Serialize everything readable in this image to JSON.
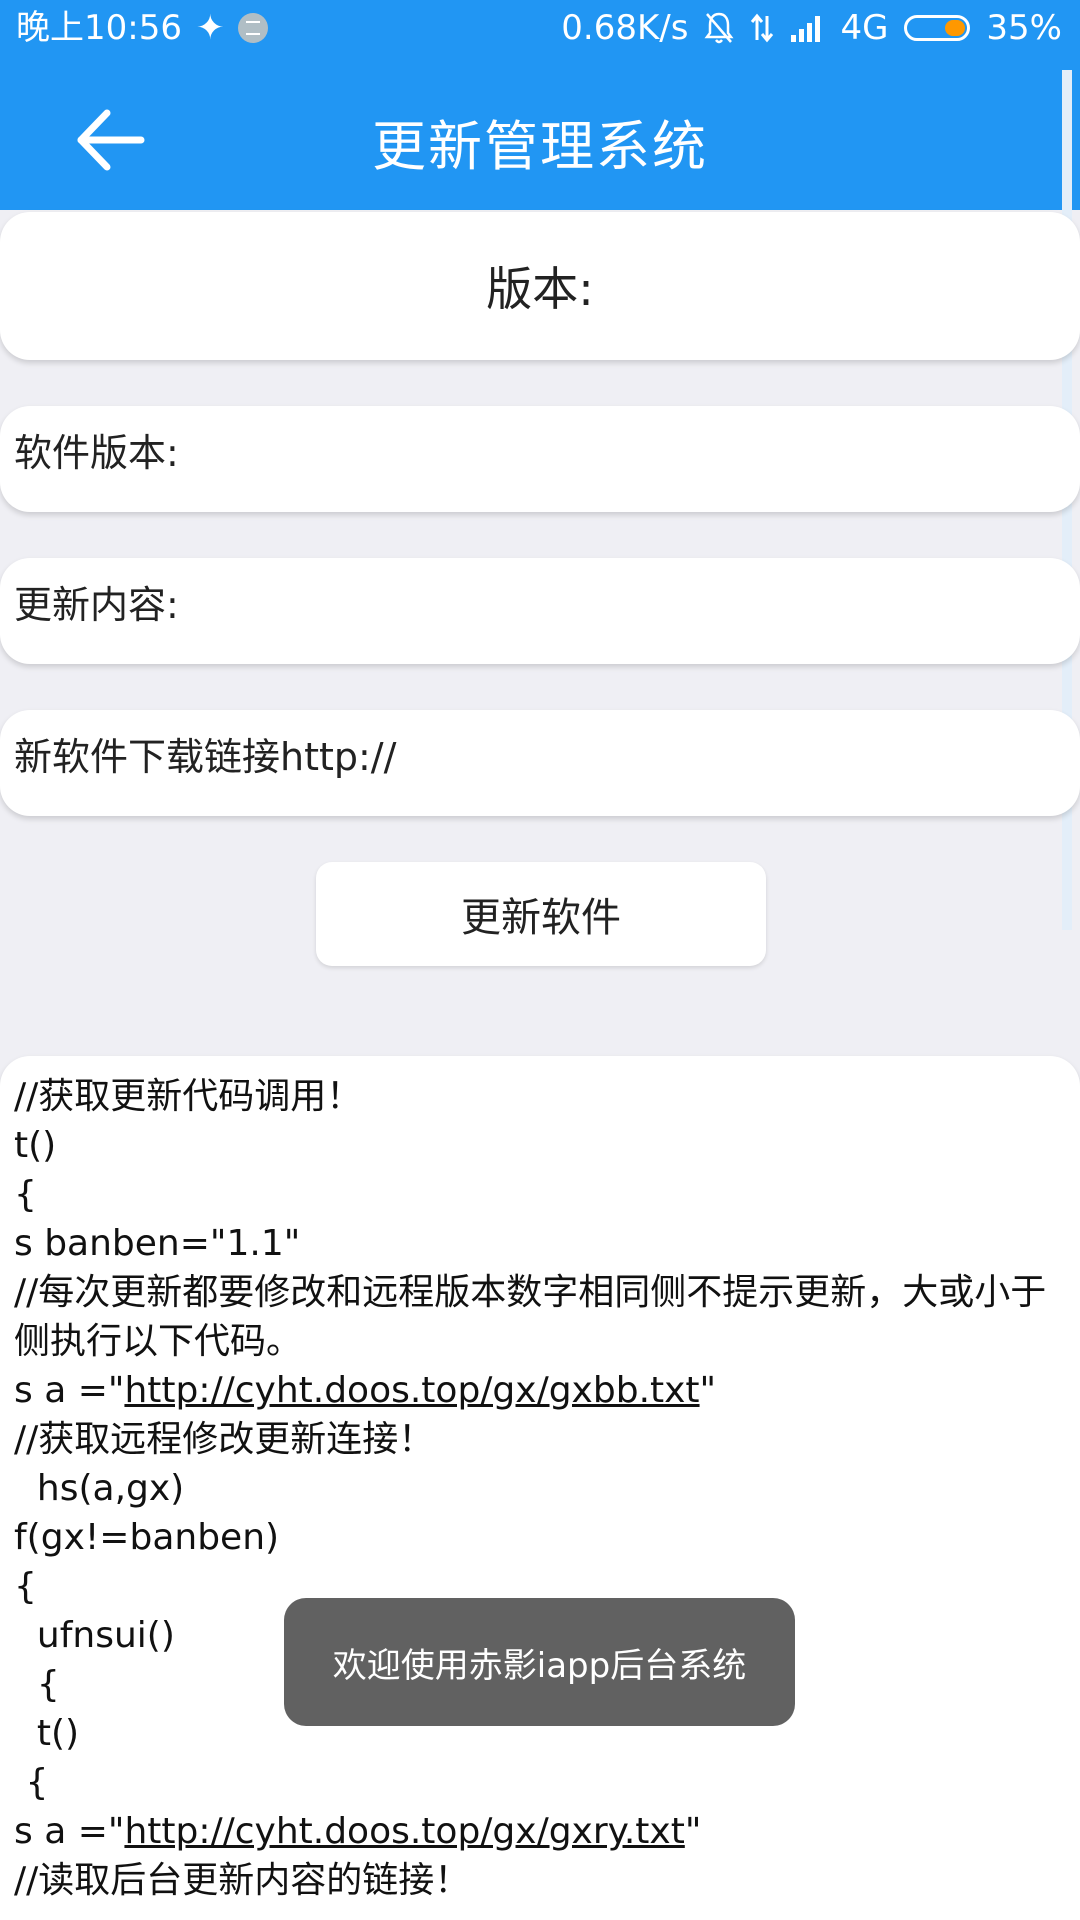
{
  "status_bar": {
    "time": "晚上10:56",
    "net_speed": "0.68K/s",
    "network": "4G",
    "battery": "35%",
    "battery_level": 0.35
  },
  "header": {
    "title": "更新管理系统",
    "back_icon": "arrow-back-icon"
  },
  "version_label": "版本:",
  "fields": {
    "software_version": "软件版本:",
    "update_content": "更新内容:",
    "download_link": "新软件下载链接http://"
  },
  "update_button": "更新软件",
  "code": {
    "l1": "//获取更新代码调用！",
    "l2": "t()",
    "l3": "{",
    "l4": "s banben=\"1.1\"",
    "l5": "//每次更新都要修改和远程版本数字相同侧不提示更新，大或小于侧执行以下代码。",
    "l6_prefix": "s a =\"",
    "l6_link": "http://cyht.doos.top/gx/gxbb.txt",
    "l6_suffix": "\"",
    "l7": "//获取远程修改更新连接！",
    "l8": "  hs(a,gx)",
    "l9": "f(gx!=banben)",
    "l10": "{",
    "l11": "  ufnsui()",
    "l12": "  {",
    "l13": "  t()",
    "l14": " {",
    "l15_prefix": "s a =\"",
    "l15_link": "http://cyht.doos.top/gx/gxry.txt",
    "l15_suffix": "\"",
    "l16": "//读取后台更新内容的链接！"
  },
  "toast": "欢迎使用赤影iapp后台系统",
  "colors": {
    "primary": "#2196f3",
    "background": "#efeff4",
    "toast": "#616161",
    "battery": "#ff9800"
  }
}
